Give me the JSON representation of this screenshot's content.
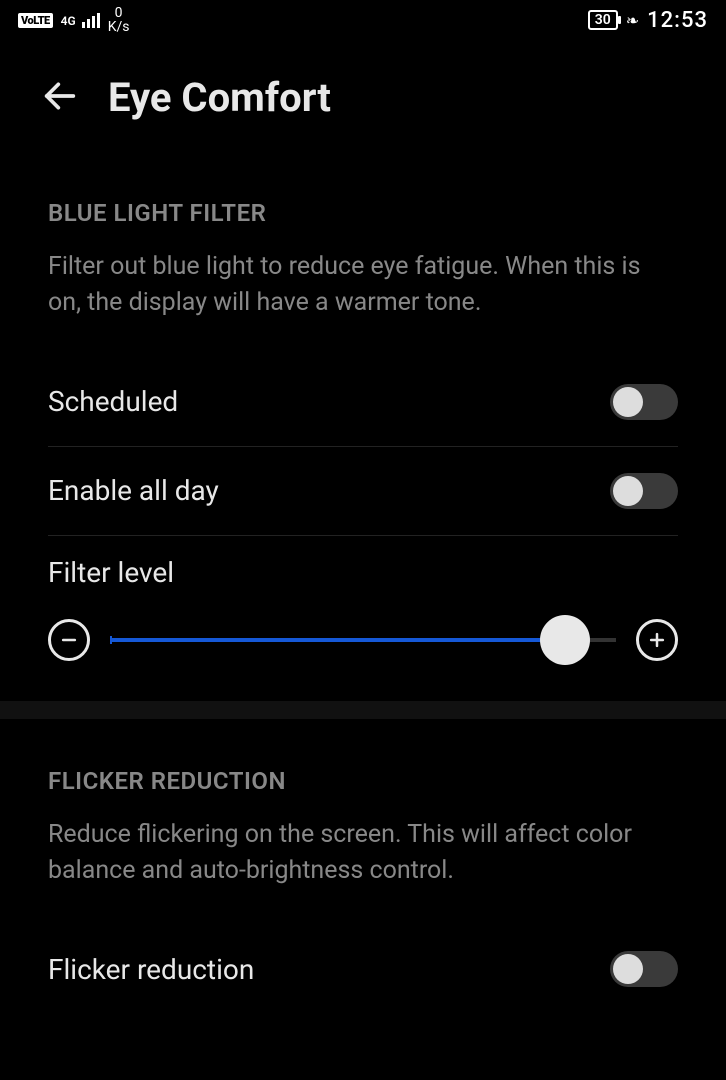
{
  "status": {
    "volte": "VoLTE",
    "net_label": "4G",
    "speed_value": "0",
    "speed_unit": "K/s",
    "battery": "30",
    "time": "12:53"
  },
  "header": {
    "title": "Eye Comfort"
  },
  "blue_light": {
    "section_title": "BLUE LIGHT FILTER",
    "description": "Filter out blue light to reduce eye fatigue. When this is on, the display will have a warmer tone.",
    "scheduled_label": "Scheduled",
    "scheduled_on": false,
    "enable_all_day_label": "Enable all day",
    "enable_all_day_on": false,
    "filter_level_label": "Filter level",
    "filter_level_pct": 90
  },
  "flicker": {
    "section_title": "FLICKER REDUCTION",
    "description": "Reduce flickering on the screen. This will affect color balance and auto-brightness control.",
    "row_label": "Flicker reduction",
    "on": false
  }
}
